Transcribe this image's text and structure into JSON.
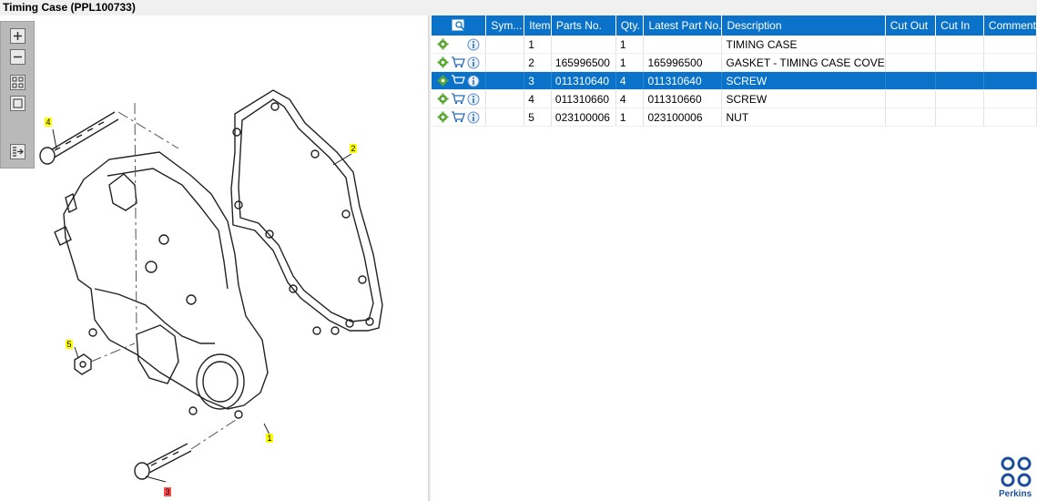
{
  "window": {
    "title": "Timing Case (PPL100733)"
  },
  "toolbar": {
    "zoom_in": "zoom-in-icon",
    "zoom_out": "zoom-out-icon",
    "fit": "fit-icon",
    "select": "select-icon",
    "export": "export-icon"
  },
  "drawing": {
    "callouts": [
      {
        "label": "1",
        "color": "#ffff00"
      },
      {
        "label": "2",
        "color": "#ffff00"
      },
      {
        "label": "3",
        "color": "#ff4a4a"
      },
      {
        "label": "4",
        "color": "#ffff00"
      },
      {
        "label": "5",
        "color": "#ffff00"
      }
    ]
  },
  "table": {
    "headers": [
      "",
      "Sym...",
      "Item",
      "Parts No.",
      "Qty.",
      "Latest Part No.",
      "Description",
      "Cut Out",
      "Cut In",
      "Comment"
    ],
    "rows": [
      {
        "cart": false,
        "item": "1",
        "parts_no": "",
        "qty": "1",
        "latest": "",
        "description": "TIMING CASE",
        "selected": false
      },
      {
        "cart": true,
        "item": "2",
        "parts_no": "165996500",
        "qty": "1",
        "latest": "165996500",
        "description": "GASKET - TIMING CASE COVE",
        "selected": false
      },
      {
        "cart": true,
        "item": "3",
        "parts_no": "011310640",
        "qty": "4",
        "latest": "011310640",
        "description": "SCREW",
        "selected": true
      },
      {
        "cart": true,
        "item": "4",
        "parts_no": "011310660",
        "qty": "4",
        "latest": "011310660",
        "description": "SCREW",
        "selected": false
      },
      {
        "cart": true,
        "item": "5",
        "parts_no": "023100006",
        "qty": "1",
        "latest": "023100006",
        "description": "NUT",
        "selected": false
      }
    ]
  },
  "brand": {
    "name": "Perkins",
    "color": "#1d4f9a"
  },
  "colors": {
    "accent": "#0a73c9",
    "gear": "#5aa832"
  }
}
